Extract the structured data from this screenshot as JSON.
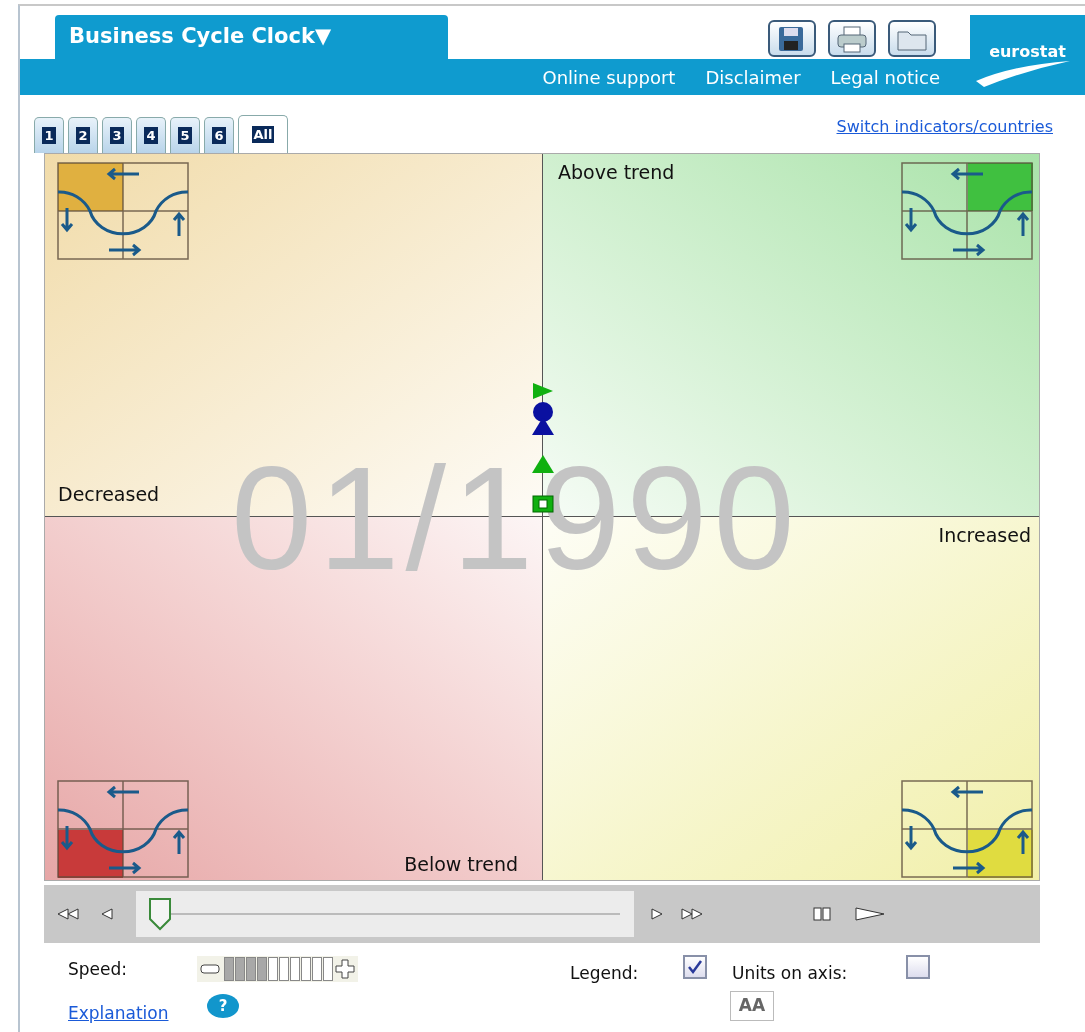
{
  "header": {
    "title": "Business Cycle Clock",
    "title_caret": "▼",
    "links": [
      "Online support",
      "Disclaimer",
      "Legal notice"
    ],
    "logo": "eurostat"
  },
  "tabs": [
    {
      "label": "1",
      "selected": false
    },
    {
      "label": "2",
      "selected": false
    },
    {
      "label": "3",
      "selected": false
    },
    {
      "label": "4",
      "selected": false
    },
    {
      "label": "5",
      "selected": false
    },
    {
      "label": "6",
      "selected": false
    },
    {
      "label": "All",
      "selected": true
    }
  ],
  "switch_link": "Switch indicators/countries",
  "clock": {
    "quadrants": [
      {
        "label": "Decreased",
        "color": "#e0b040"
      },
      {
        "label": "Above trend",
        "color": "#40c040"
      },
      {
        "label": "Below trend",
        "color": "#c83a3a"
      },
      {
        "label": "Increased",
        "color": "#e0dc40"
      }
    ],
    "date": "01/1990",
    "markers": [
      {
        "kind": "flag",
        "color": "#10b010"
      },
      {
        "kind": "circle",
        "color": "#0a10a0"
      },
      {
        "kind": "triangle",
        "color": "#0a10a0"
      },
      {
        "kind": "triangle",
        "color": "#10b010"
      },
      {
        "kind": "square",
        "color": "#10b010"
      }
    ]
  },
  "timeline": {
    "level": 0
  },
  "speed": {
    "label": "Speed:",
    "level": 0.4
  },
  "legend": {
    "label": "Legend:",
    "checked": true
  },
  "units_on_axis": {
    "label": "Units on axis:",
    "checked": false
  },
  "explanation": "Explanation",
  "help": "?",
  "font_size": "AA"
}
